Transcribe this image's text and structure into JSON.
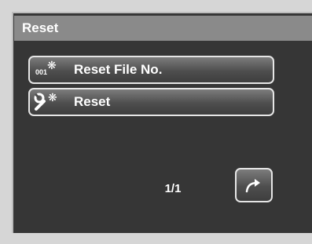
{
  "header": {
    "title": "Reset"
  },
  "menu": {
    "items": [
      {
        "label": "Reset File No.",
        "icon": "reset-file-number-icon",
        "icon_text": "001"
      },
      {
        "label": "Reset",
        "icon": "wrench-reset-icon"
      }
    ]
  },
  "footer": {
    "page_indicator": "1/1",
    "back_icon": "return-arrow-icon"
  },
  "colors": {
    "background": "#363636",
    "titlebar": "#8a8a8a",
    "button_border": "#e6e6e6",
    "text": "#ffffff"
  }
}
